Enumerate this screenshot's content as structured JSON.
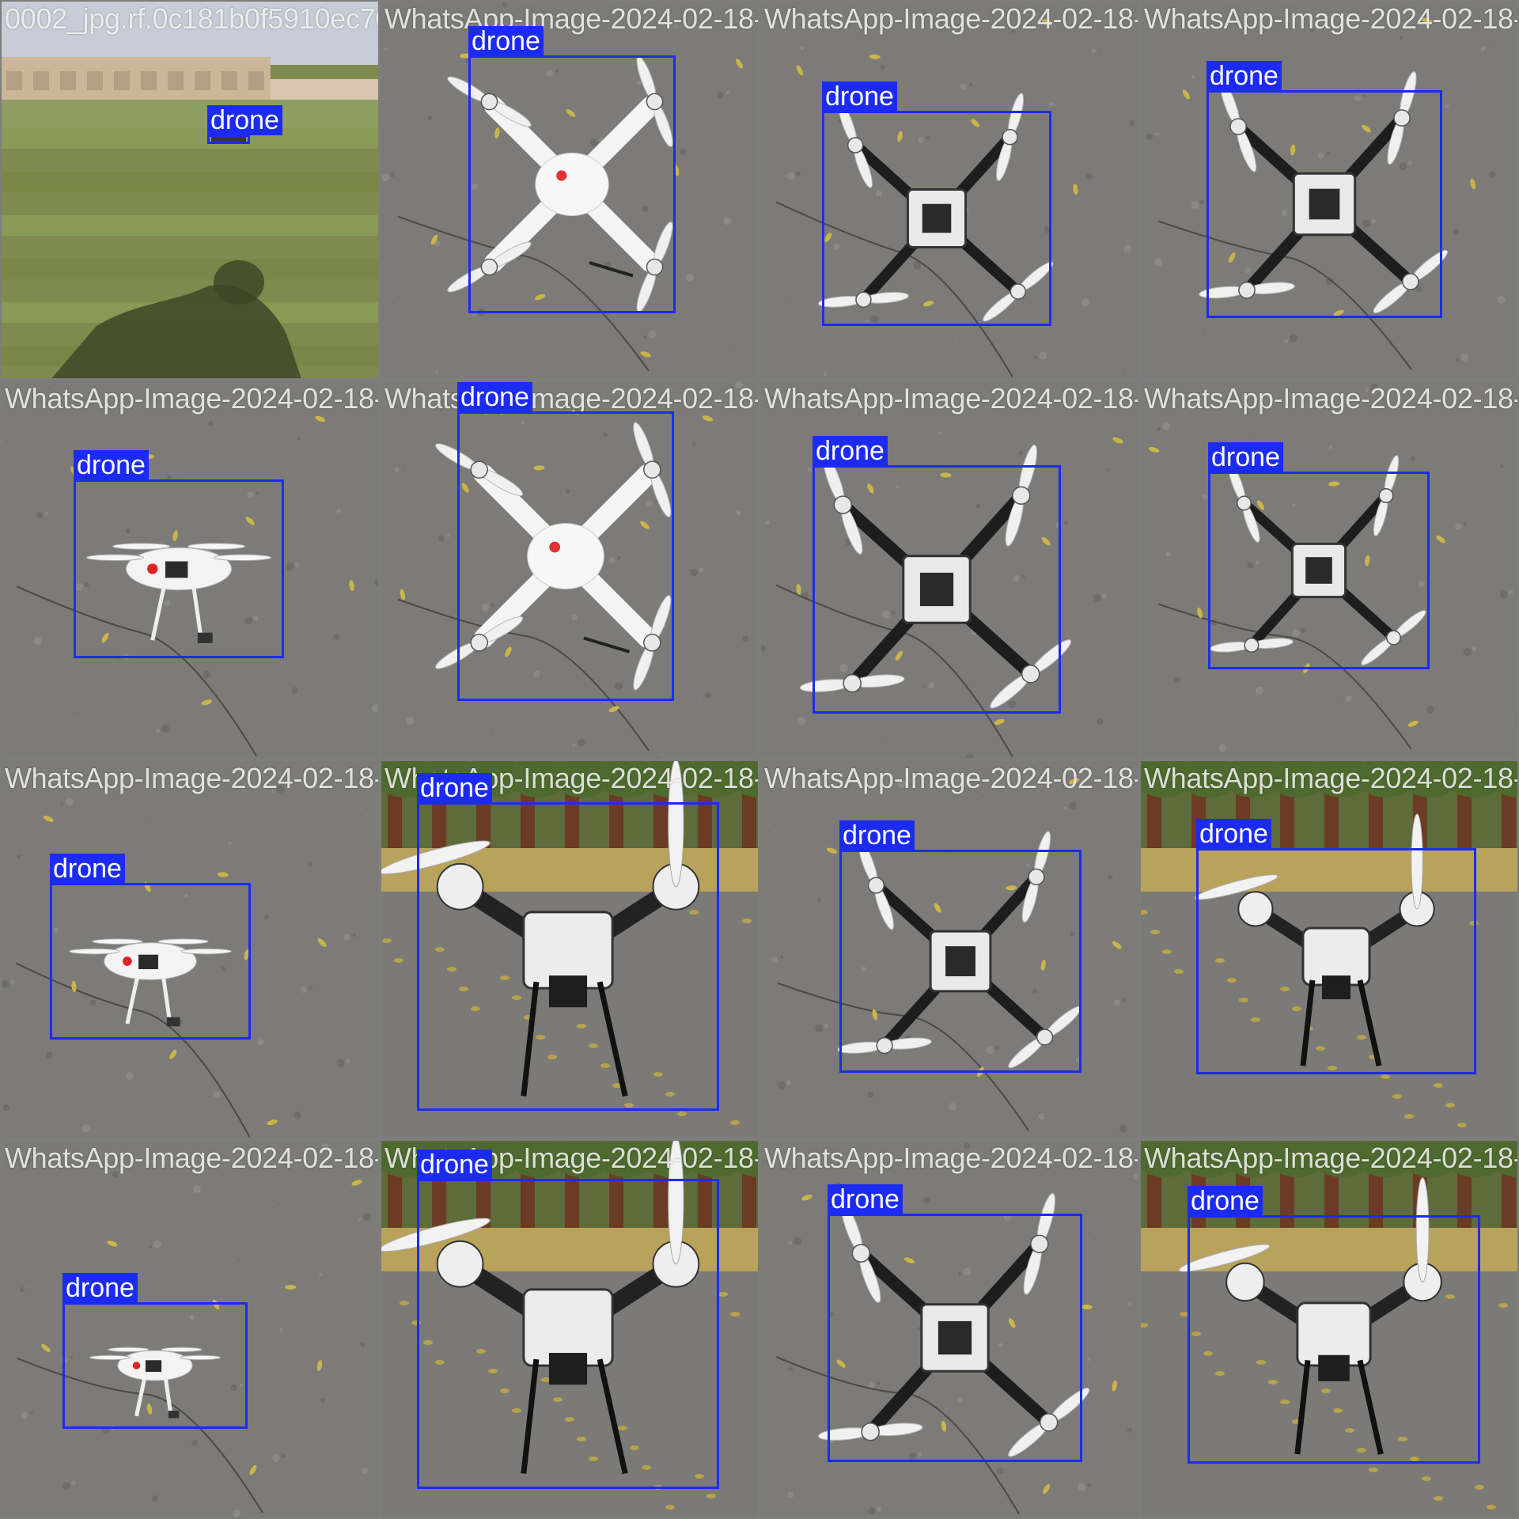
{
  "mosaic": {
    "label_color": "#1c2bf2",
    "tiles": [
      {
        "filename": "0002_jpg.rf.0c181b0f5910ec7046a458305f15",
        "scene": "field",
        "drone": "small-distant",
        "detections": [
          {
            "label": "drone"
          }
        ]
      },
      {
        "filename": "WhatsApp-Image-2024-02-18-at-17.16.01",
        "scene": "concrete",
        "drone": "white-quad",
        "detections": [
          {
            "label": "drone"
          }
        ]
      },
      {
        "filename": "WhatsApp-Image-2024-02-18-at-17.16.59.1",
        "scene": "concrete",
        "drone": "frame-quad",
        "detections": [
          {
            "label": "drone"
          }
        ]
      },
      {
        "filename": "WhatsApp-Image-2024-02-18-at-17.16.59.1",
        "scene": "concrete",
        "drone": "frame-quad",
        "detections": [
          {
            "label": "drone"
          }
        ]
      },
      {
        "filename": "WhatsApp-Image-2024-02-18-at-17.16.59.1",
        "scene": "concrete",
        "drone": "phantom-side",
        "detections": [
          {
            "label": "drone"
          }
        ]
      },
      {
        "filename": "WhatsApp-Image-2024-02-18-at-17.16.01",
        "scene": "concrete",
        "drone": "white-quad",
        "detections": [
          {
            "label": "drone"
          }
        ]
      },
      {
        "filename": "WhatsApp-Image-2024-02-18-at-17.16.01",
        "scene": "concrete",
        "drone": "frame-quad",
        "detections": [
          {
            "label": "drone"
          }
        ]
      },
      {
        "filename": "WhatsApp-Image-2024-02-18-at-17.16.59.1",
        "scene": "concrete",
        "drone": "frame-quad",
        "detections": [
          {
            "label": "drone"
          }
        ]
      },
      {
        "filename": "WhatsApp-Image-2024-02-18-at-17.16.59.1",
        "scene": "concrete",
        "drone": "phantom-side",
        "detections": [
          {
            "label": "drone"
          }
        ]
      },
      {
        "filename": "WhatsApp-Image-2024-02-18-at-17.16.01",
        "scene": "park",
        "drone": "front-quad",
        "detections": [
          {
            "label": "drone"
          }
        ]
      },
      {
        "filename": "WhatsApp-Image-2024-02-18-at-17.16.59.1",
        "scene": "concrete",
        "drone": "frame-quad",
        "detections": [
          {
            "label": "drone"
          }
        ]
      },
      {
        "filename": "WhatsApp-Image-2024-02-18-at-17.16.59.1",
        "scene": "park",
        "drone": "front-quad",
        "detections": [
          {
            "label": "drone"
          }
        ]
      },
      {
        "filename": "WhatsApp-Image-2024-02-18-at-17.16.59.1",
        "scene": "concrete",
        "drone": "phantom-side",
        "detections": [
          {
            "label": "drone"
          }
        ]
      },
      {
        "filename": "WhatsApp-Image-2024-02-18-at-17.16.01",
        "scene": "park",
        "drone": "front-quad",
        "detections": [
          {
            "label": "drone"
          }
        ]
      },
      {
        "filename": "WhatsApp-Image-2024-02-18-at-17.16.59.1",
        "scene": "concrete",
        "drone": "frame-quad",
        "detections": [
          {
            "label": "drone"
          }
        ]
      },
      {
        "filename": "WhatsApp-Image-2024-02-18-at-17.16.59.1",
        "scene": "park",
        "drone": "front-quad",
        "detections": [
          {
            "label": "drone"
          }
        ]
      }
    ]
  }
}
